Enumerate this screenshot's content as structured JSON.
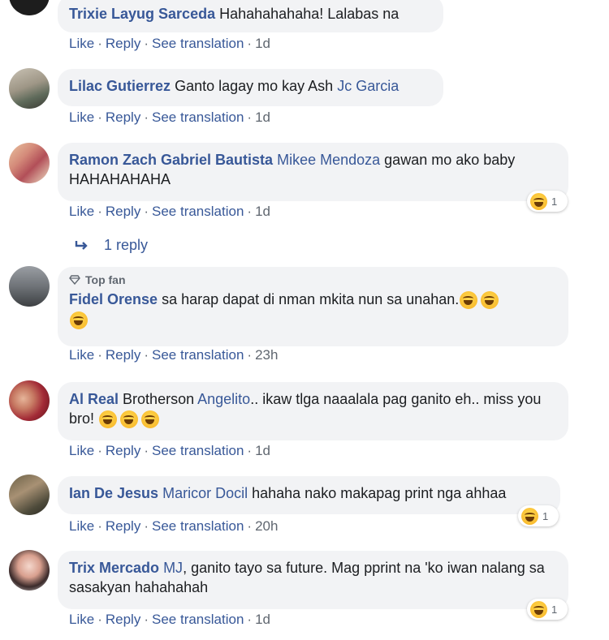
{
  "labels": {
    "like": "Like",
    "reply": "Reply",
    "see_translation": "See translation",
    "top_fan": "Top fan",
    "dot": "·"
  },
  "comments": [
    {
      "author": "Trixie Layug Sarceda",
      "text": "Hahahahahaha! Lalabas na",
      "time": "1d"
    },
    {
      "author": "Lilac Gutierrez",
      "text": "Ganto lagay mo kay Ash",
      "mention": "Jc Garcia",
      "time": "1d"
    },
    {
      "author": "Ramon Zach Gabriel Bautista",
      "mention": "Mikee Mendoza",
      "text": "gawan mo ako baby HAHAHAHAHA",
      "time": "1d",
      "reaction_count": "1",
      "reply_count_label": "1 reply"
    },
    {
      "author": "Fidel Orense",
      "text": "sa harap dapat di nman mkita nun sa unahan.",
      "time": "23h",
      "badge": "Top fan"
    },
    {
      "author": "Al Real",
      "text_before": "Brotherson",
      "mention": "Angelito",
      "text": ".. ikaw tlga naaalala pag ganito eh.. miss you bro!",
      "time": "1d"
    },
    {
      "author": "Ian De Jesus",
      "mention": "Maricor Docil",
      "text": "hahaha nako makapag print nga ahhaa",
      "time": "20h",
      "reaction_count": "1"
    },
    {
      "author": "Trix Mercado",
      "mention": "MJ",
      "text": ", ganito tayo sa future. Mag pprint na 'ko iwan nalang sa sasakyan hahahahah",
      "time": "1d",
      "reaction_count": "1"
    }
  ],
  "colors": {
    "link": "#385898",
    "bubble": "#f2f3f5",
    "meta": "#606770",
    "emoji": "#f7b125"
  },
  "icons": [
    "laughing-emoji-icon",
    "top-fan-diamond-icon",
    "reply-arrow-icon"
  ]
}
